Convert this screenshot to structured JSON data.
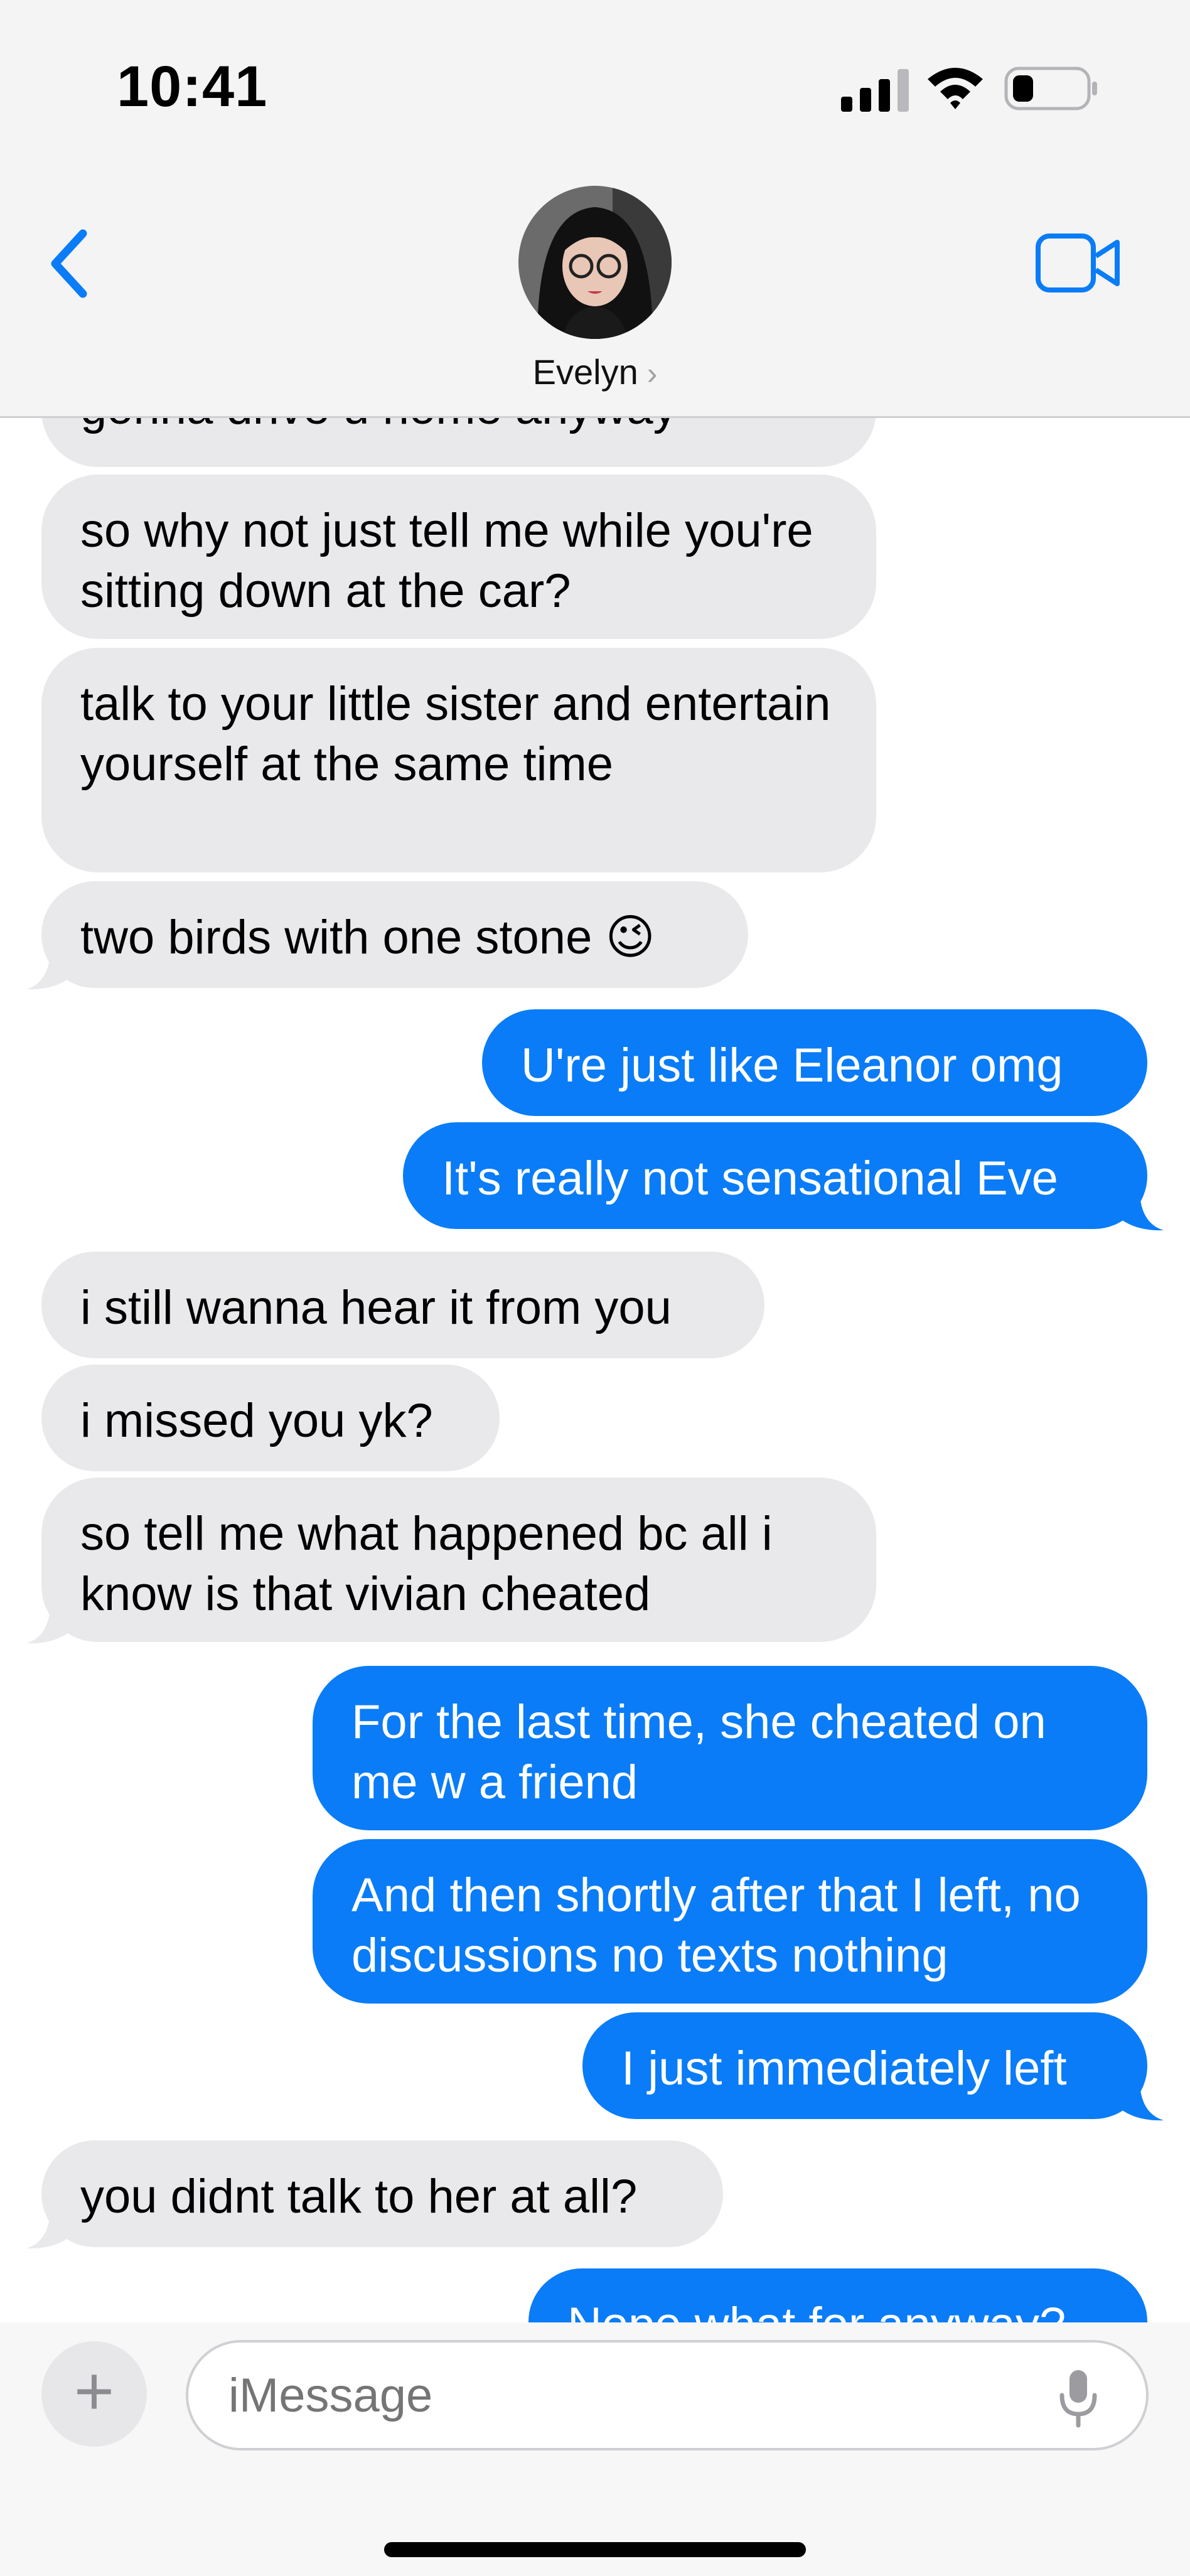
{
  "status_bar": {
    "time": "10:41"
  },
  "header": {
    "contact_name": "Evelyn"
  },
  "messages": [
    {
      "side": "in",
      "text": "gonna drive u home anyway"
    },
    {
      "side": "in",
      "text": "so why not just tell me while you're sitting down at the car?"
    },
    {
      "side": "in",
      "text": "talk to your little sister and entertain yourself at the same time"
    },
    {
      "side": "in",
      "text": "two birds with one stone 😉"
    },
    {
      "side": "out",
      "text": "U're just like Eleanor omg"
    },
    {
      "side": "out",
      "text": "It's really not sensational Eve"
    },
    {
      "side": "in",
      "text": "i still wanna hear it from you"
    },
    {
      "side": "in",
      "text": "i missed you yk?"
    },
    {
      "side": "in",
      "text": "so tell me what happened bc all i know is that vivian cheated"
    },
    {
      "side": "out",
      "text": "For the last time, she cheated on me w a friend"
    },
    {
      "side": "out",
      "text": "And then shortly after that I left, no discussions no texts nothing"
    },
    {
      "side": "out",
      "text": "I just immediately left"
    },
    {
      "side": "in",
      "text": "you didnt talk to her at all?"
    },
    {
      "side": "out",
      "text": "Nope what for anyway?"
    }
  ],
  "compose": {
    "placeholder": "iMessage",
    "plus_label": "+"
  },
  "icons": {
    "back": "chevron-left-icon",
    "video": "video-camera-icon",
    "mic": "microphone-icon",
    "signal": "cellular-signal-icon",
    "wifi": "wifi-icon",
    "battery": "battery-icon"
  },
  "colors": {
    "outgoing": "#0a7cf7",
    "incoming": "#e9e9eb",
    "accent": "#0a7cf7"
  }
}
